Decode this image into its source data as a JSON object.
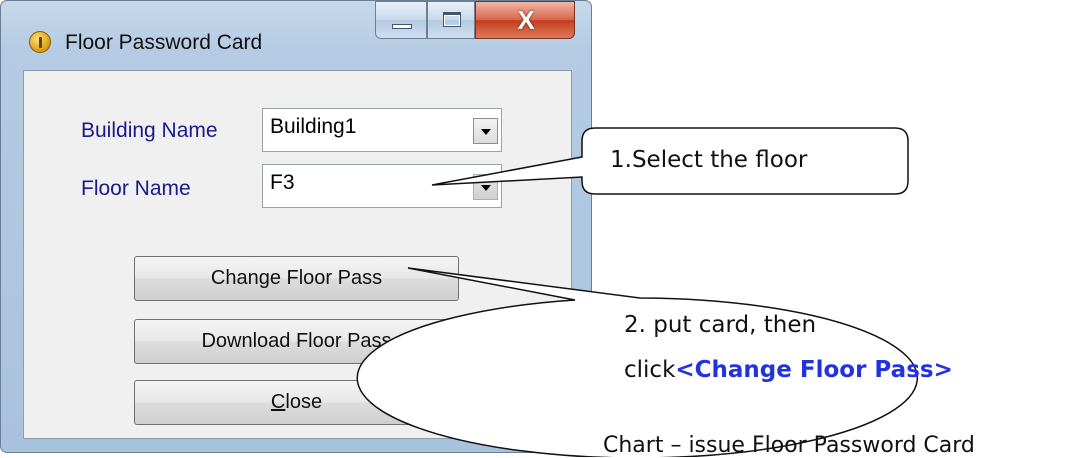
{
  "window": {
    "title": "Floor Password Card",
    "icon": "app-info-icon",
    "controls": {
      "minimize": "minimize-icon",
      "maximize": "maximize-icon",
      "close_glyph": "X"
    }
  },
  "form": {
    "building_label": "Building Name",
    "building_value": "Building1",
    "floor_label": "Floor Name",
    "floor_value": "F3"
  },
  "buttons": {
    "change": "Change Floor Pass",
    "download": "Download Floor Pass",
    "close_accel": "C",
    "close_rest": "lose"
  },
  "callouts": {
    "step1": "1.Select the floor",
    "step2_line1": "2. put card, then",
    "step2_prefix": "click",
    "step2_link": "<Change Floor Pass>"
  },
  "caption": "Chart – issue Floor Password Card",
  "colors": {
    "label": "#1a1a8c",
    "link": "#2233dd",
    "close_button": "#c43b1e"
  }
}
